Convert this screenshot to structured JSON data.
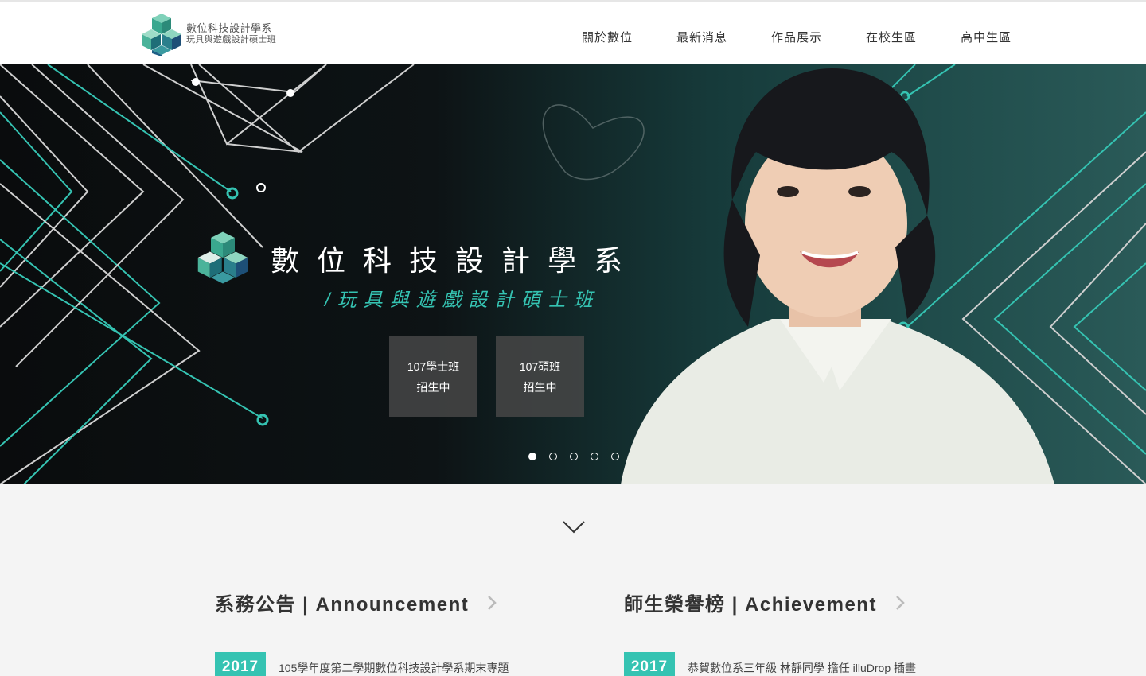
{
  "header": {
    "logo_line1": "數位科技設計學系",
    "logo_line2": "玩具與遊戲設計碩士班",
    "nav": [
      "關於數位",
      "最新消息",
      "作品展示",
      "在校生區",
      "高中生區"
    ]
  },
  "hero": {
    "title": "數位科技設計學系",
    "subtitle": "/玩具與遊戲設計碩士班",
    "cta": [
      {
        "line1": "107學士班",
        "line2": "招生中"
      },
      {
        "line1": "107碩班",
        "line2": "招生中"
      }
    ],
    "slides": 5,
    "active_slide": 1
  },
  "sections": {
    "announcement": {
      "title": "系務公告 | Announcement",
      "year": "2017",
      "item": "105學年度第二學期數位科技設計學系期末專題"
    },
    "achievement": {
      "title": "師生榮譽榜 | Achievement",
      "year": "2017",
      "item": "恭賀數位系三年級 林靜同學 擔任 illuDrop 插畫"
    }
  },
  "colors": {
    "accent": "#35c3b2",
    "header_bg": "#ffffff",
    "page_bg": "#f4f4f4"
  }
}
